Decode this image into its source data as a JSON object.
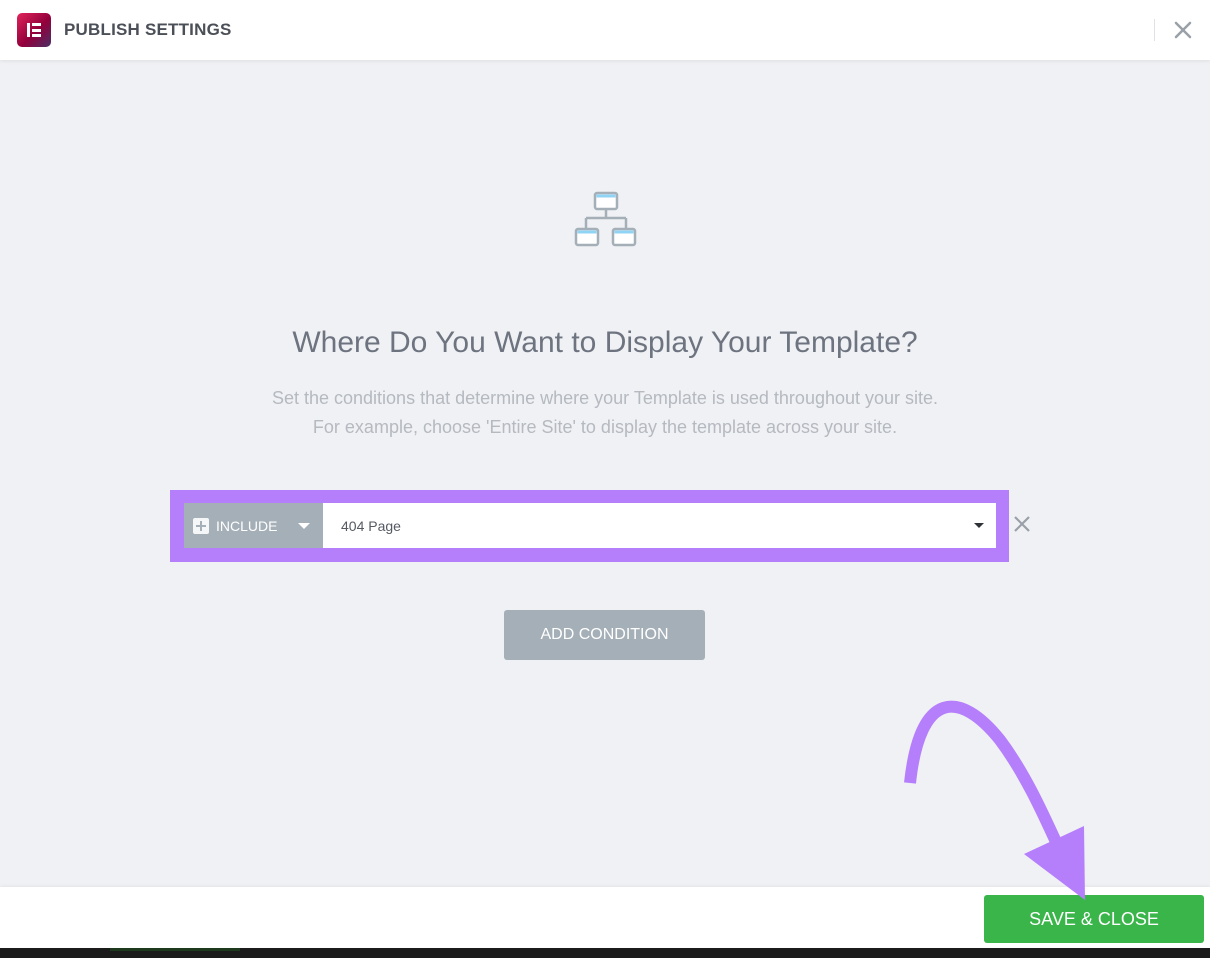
{
  "header": {
    "title": "PUBLISH SETTINGS",
    "logo_icon": "elementor-logo-icon",
    "close_icon": "close-icon"
  },
  "main": {
    "icon": "sitemap-hierarchy-icon",
    "heading": "Where Do You Want to Display Your Template?",
    "description_line1": "Set the conditions that determine where your Template is used throughout your site.",
    "description_line2": "For example, choose 'Entire Site' to display the template across your site.",
    "condition": {
      "type_value": "INCLUDE",
      "type_icon": "plus-square-icon",
      "page_value": "404 Page",
      "remove_icon": "close-icon"
    },
    "add_condition_label": "ADD CONDITION"
  },
  "footer": {
    "save_close_label": "SAVE & CLOSE"
  },
  "colors": {
    "highlight": "#b57ffb",
    "save_green": "#39b54a",
    "gray_button": "#a4afb7",
    "annotation_arrow": "#b57ffb"
  }
}
